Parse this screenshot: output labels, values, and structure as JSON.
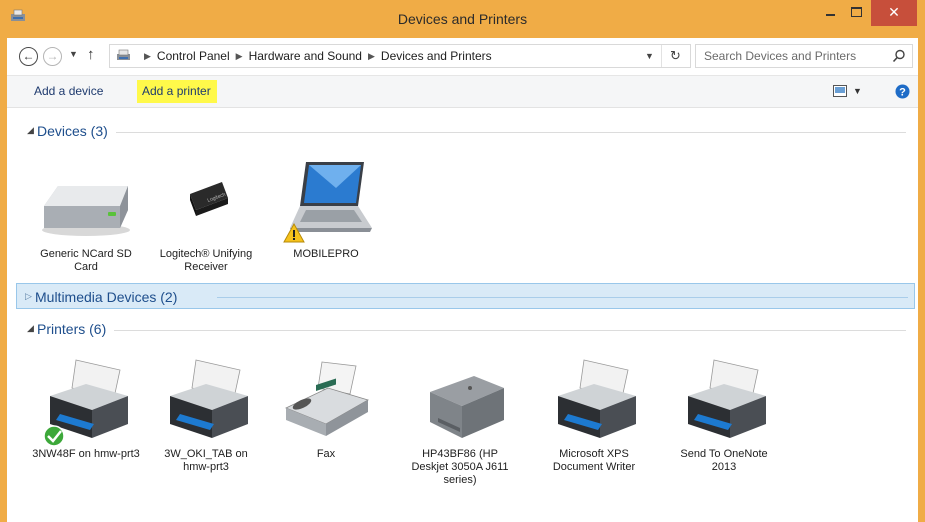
{
  "window": {
    "title": "Devices and Printers",
    "close_glyph": "✕"
  },
  "nav": {
    "breadcrumbs": [
      "Control Panel",
      "Hardware and Sound",
      "Devices and Printers"
    ],
    "search_placeholder": "Search Devices and Printers"
  },
  "commands": {
    "add_device": "Add a device",
    "add_printer": "Add a printer"
  },
  "groups": {
    "devices": {
      "label": "Devices (3)",
      "items": [
        {
          "name": "Generic NCard SD Card",
          "icon": "sd-card-drive-icon"
        },
        {
          "name": "Logitech® Unifying Receiver",
          "icon": "usb-receiver-icon"
        },
        {
          "name": "MOBILEPRO",
          "icon": "laptop-warning-icon"
        }
      ]
    },
    "multimedia": {
      "label": "Multimedia Devices (2)"
    },
    "printers": {
      "label": "Printers (6)",
      "items": [
        {
          "name": "3NW48F on hmw-prt3",
          "icon": "printer-default-icon"
        },
        {
          "name": "3W_OKI_TAB on hmw-prt3",
          "icon": "printer-icon"
        },
        {
          "name": "Fax",
          "icon": "fax-icon"
        },
        {
          "name": "HP43BF86 (HP Deskjet 3050A J611 series)",
          "icon": "inkjet-printer-icon"
        },
        {
          "name": "Microsoft XPS Document Writer",
          "icon": "printer-icon"
        },
        {
          "name": "Send To OneNote 2013",
          "icon": "printer-icon"
        }
      ]
    }
  },
  "colors": {
    "window_frame": "#f0ac46",
    "close_button": "#c74f3b",
    "highlight": "#fff94a",
    "link_blue": "#1e4e8c"
  }
}
